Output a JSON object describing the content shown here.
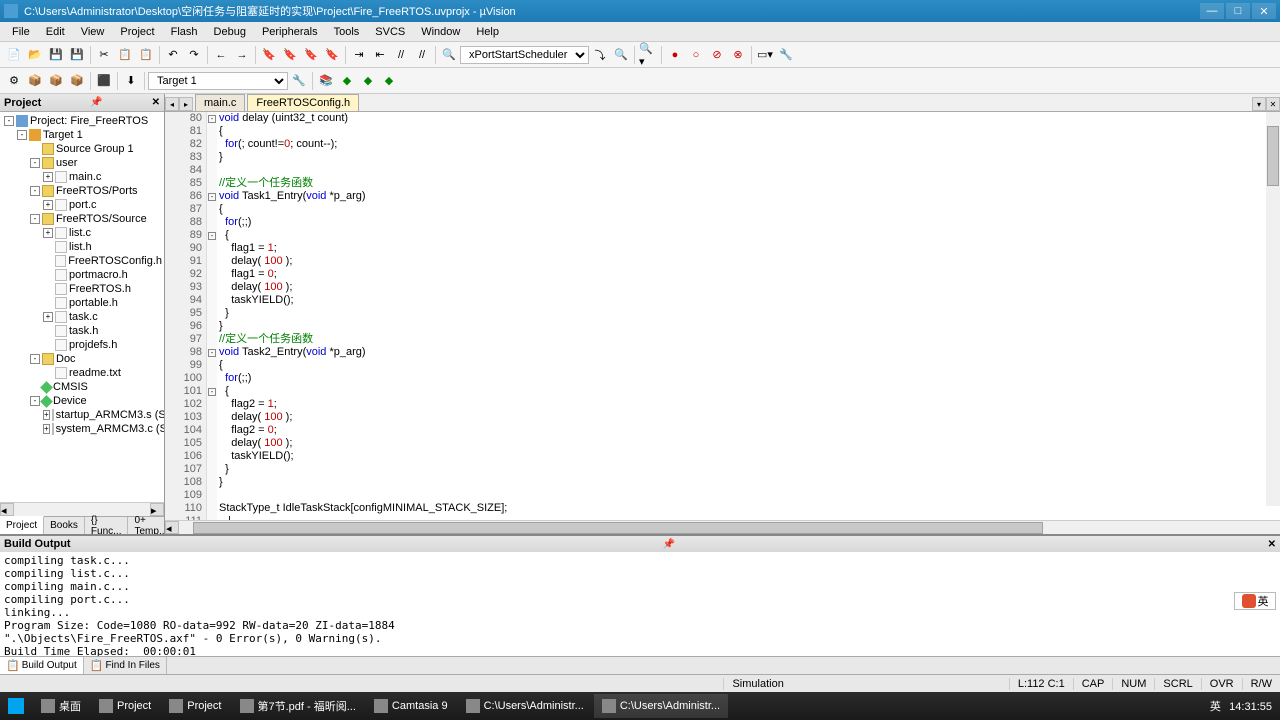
{
  "titlebar": {
    "text": "C:\\Users\\Administrator\\Desktop\\空闲任务与阻塞延时的实现\\Project\\Fire_FreeRTOS.uvprojx - µVision"
  },
  "menus": [
    "File",
    "Edit",
    "View",
    "Project",
    "Flash",
    "Debug",
    "Peripherals",
    "Tools",
    "SVCS",
    "Window",
    "Help"
  ],
  "toolbar": {
    "function_combo": "xPortStartScheduler",
    "target_combo": "Target 1"
  },
  "project_panel": {
    "title": "Project",
    "tree": [
      {
        "depth": 0,
        "exp": "-",
        "icon": "proj",
        "label": "Project: Fire_FreeRTOS"
      },
      {
        "depth": 1,
        "exp": "-",
        "icon": "target",
        "label": "Target 1"
      },
      {
        "depth": 2,
        "exp": "",
        "icon": "folder",
        "label": "Source Group 1"
      },
      {
        "depth": 2,
        "exp": "-",
        "icon": "folder",
        "label": "user"
      },
      {
        "depth": 3,
        "exp": "+",
        "icon": "file",
        "label": "main.c"
      },
      {
        "depth": 2,
        "exp": "-",
        "icon": "folder",
        "label": "FreeRTOS/Ports"
      },
      {
        "depth": 3,
        "exp": "+",
        "icon": "file",
        "label": "port.c"
      },
      {
        "depth": 2,
        "exp": "-",
        "icon": "folder",
        "label": "FreeRTOS/Source"
      },
      {
        "depth": 3,
        "exp": "+",
        "icon": "file",
        "label": "list.c"
      },
      {
        "depth": 3,
        "exp": "",
        "icon": "file",
        "label": "list.h"
      },
      {
        "depth": 3,
        "exp": "",
        "icon": "file",
        "label": "FreeRTOSConfig.h"
      },
      {
        "depth": 3,
        "exp": "",
        "icon": "file",
        "label": "portmacro.h"
      },
      {
        "depth": 3,
        "exp": "",
        "icon": "file",
        "label": "FreeRTOS.h"
      },
      {
        "depth": 3,
        "exp": "",
        "icon": "file",
        "label": "portable.h"
      },
      {
        "depth": 3,
        "exp": "+",
        "icon": "file",
        "label": "task.c"
      },
      {
        "depth": 3,
        "exp": "",
        "icon": "file",
        "label": "task.h"
      },
      {
        "depth": 3,
        "exp": "",
        "icon": "file",
        "label": "projdefs.h"
      },
      {
        "depth": 2,
        "exp": "-",
        "icon": "folder",
        "label": "Doc"
      },
      {
        "depth": 3,
        "exp": "",
        "icon": "file",
        "label": "readme.txt"
      },
      {
        "depth": 2,
        "exp": "",
        "icon": "diamond",
        "label": "CMSIS"
      },
      {
        "depth": 2,
        "exp": "-",
        "icon": "diamond",
        "label": "Device"
      },
      {
        "depth": 3,
        "exp": "+",
        "icon": "file",
        "label": "startup_ARMCM3.s (Startup)"
      },
      {
        "depth": 3,
        "exp": "+",
        "icon": "file",
        "label": "system_ARMCM3.c (Startup)"
      }
    ],
    "tabs": [
      "Project",
      "Books",
      "{} Func...",
      "0+ Temp..."
    ]
  },
  "editor": {
    "tabs": [
      {
        "label": "main.c",
        "active": false
      },
      {
        "label": "FreeRTOSConfig.h",
        "active": true
      }
    ],
    "first_line": 80,
    "current_line_index": 32,
    "lines": [
      {
        "html": "<span class='kw'>void</span> delay (uint32_t count)",
        "fold": "-"
      },
      {
        "html": "{",
        "fold": ""
      },
      {
        "html": "  <span class='kw'>for</span>(; count!=<span class='num'>0</span>; count--);",
        "fold": ""
      },
      {
        "html": "}",
        "fold": ""
      },
      {
        "html": "",
        "fold": ""
      },
      {
        "html": "<span class='cmt'>//定义一个任务函数</span>",
        "fold": ""
      },
      {
        "html": "<span class='kw'>void</span> Task1_Entry(<span class='kw'>void</span> *p_arg)",
        "fold": "-"
      },
      {
        "html": "{",
        "fold": ""
      },
      {
        "html": "  <span class='kw'>for</span>(;;)",
        "fold": ""
      },
      {
        "html": "  {",
        "fold": "-"
      },
      {
        "html": "    flag1 = <span class='num'>1</span>;",
        "fold": ""
      },
      {
        "html": "    delay( <span class='num'>100</span> );",
        "fold": ""
      },
      {
        "html": "    flag1 = <span class='num'>0</span>;",
        "fold": ""
      },
      {
        "html": "    delay( <span class='num'>100</span> );",
        "fold": ""
      },
      {
        "html": "    taskYIELD();",
        "fold": ""
      },
      {
        "html": "  }",
        "fold": ""
      },
      {
        "html": "}",
        "fold": ""
      },
      {
        "html": "<span class='cmt'>//定义一个任务函数</span>",
        "fold": ""
      },
      {
        "html": "<span class='kw'>void</span> Task2_Entry(<span class='kw'>void</span> *p_arg)",
        "fold": "-"
      },
      {
        "html": "{",
        "fold": ""
      },
      {
        "html": "  <span class='kw'>for</span>(;;)",
        "fold": ""
      },
      {
        "html": "  {",
        "fold": "-"
      },
      {
        "html": "    flag2 = <span class='num'>1</span>;",
        "fold": ""
      },
      {
        "html": "    delay( <span class='num'>100</span> );",
        "fold": ""
      },
      {
        "html": "    flag2 = <span class='num'>0</span>;",
        "fold": ""
      },
      {
        "html": "    delay( <span class='num'>100</span> );",
        "fold": ""
      },
      {
        "html": "    taskYIELD();",
        "fold": ""
      },
      {
        "html": "  }",
        "fold": ""
      },
      {
        "html": "}",
        "fold": ""
      },
      {
        "html": "",
        "fold": ""
      },
      {
        "html": "StackType_t IdleTaskStack[configMINIMAL_STACK_SIZE];",
        "fold": ""
      },
      {
        "html": "   |",
        "fold": ""
      },
      {
        "html": "",
        "fold": ""
      },
      {
        "html": "",
        "fold": ""
      }
    ]
  },
  "build": {
    "title": "Build Output",
    "text": "compiling task.c...\ncompiling list.c...\ncompiling main.c...\ncompiling port.c...\nlinking...\nProgram Size: Code=1080 RO-data=992 RW-data=20 ZI-data=1884\n\".\\Objects\\Fire_FreeRTOS.axf\" - 0 Error(s), 0 Warning(s).\nBuild Time Elapsed:  00:00:01",
    "tabs": [
      "Build Output",
      "Find In Files"
    ]
  },
  "status": {
    "mode": "Simulation",
    "cursor": "L:112 C:1",
    "indicators": [
      "CAP",
      "NUM",
      "SCRL",
      "OVR",
      "R/W"
    ]
  },
  "taskbar": {
    "items": [
      {
        "label": "桌面"
      },
      {
        "label": "Project"
      },
      {
        "label": "Project"
      },
      {
        "label": "第7节.pdf - 福昕阅..."
      },
      {
        "label": "Camtasia 9"
      },
      {
        "label": "C:\\Users\\Administr..."
      },
      {
        "label": "C:\\Users\\Administr...",
        "active": true
      }
    ],
    "ime": "英",
    "time": "14:31:55"
  }
}
